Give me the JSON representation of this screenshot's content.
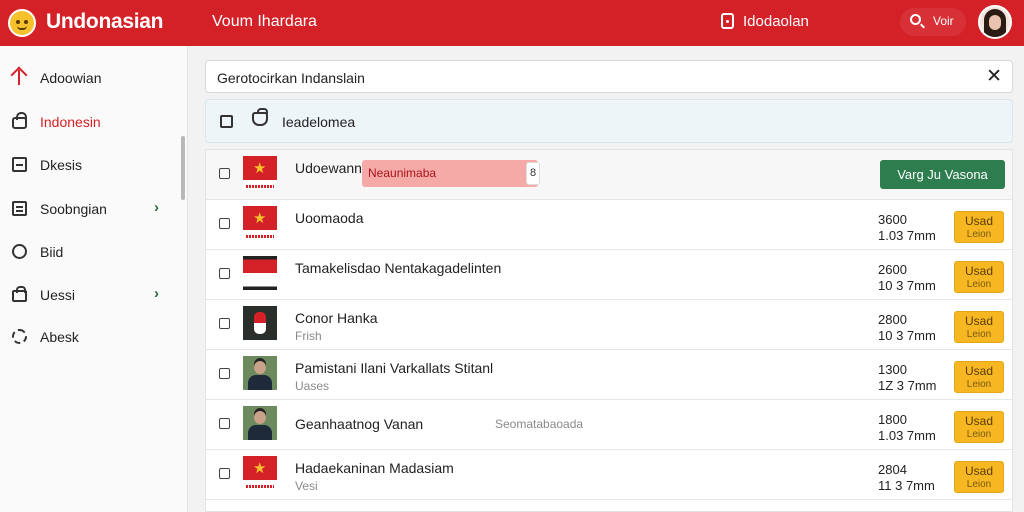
{
  "header": {
    "title": "Undonasian",
    "subtitle": "Voum Ihardara",
    "location": "Idodaolan",
    "search_label": "Voir"
  },
  "sidebar": {
    "items": [
      {
        "label": "Adoowian",
        "icon": "home-icon",
        "active": false
      },
      {
        "label": "Indonesin",
        "icon": "lock-icon",
        "active": true
      },
      {
        "label": "Dkesis",
        "icon": "document-icon",
        "active": false
      },
      {
        "label": "Soobngian",
        "icon": "list-icon",
        "active": false,
        "expandable": true
      },
      {
        "label": "Biid",
        "icon": "circle-icon",
        "active": false
      },
      {
        "label": "Uessi",
        "icon": "bag-icon",
        "active": false,
        "expandable": true
      },
      {
        "label": "Abesk",
        "icon": "gear-icon",
        "active": false
      }
    ]
  },
  "search": {
    "value": "Gerotocirkan Indanslain"
  },
  "filter": {
    "label": "Ieadelomea"
  },
  "list": {
    "rows": [
      {
        "title": "Udoewann",
        "tag": "Neaunimaba",
        "tag_badge": "8",
        "action": "Varg Ju Vasona",
        "thumb": "flag-vn"
      },
      {
        "title": "Uoomaoda",
        "sub": "",
        "num1": "3600",
        "num2": "1.03 7mm",
        "btn1": "Usad",
        "btn2": "Leion",
        "thumb": "flag-vn"
      },
      {
        "title": "Tamakelisdao Nentakagadelinten",
        "sub": "",
        "num1": "2600",
        "num2": "10 3 7mm",
        "btn1": "Usad",
        "btn2": "Leion",
        "thumb": "flag-id"
      },
      {
        "title": "Conor Hanka",
        "sub": "Frish",
        "num1": "2800",
        "num2": "10 3 7mm",
        "btn1": "Usad",
        "btn2": "Leion",
        "thumb": "dark"
      },
      {
        "title": "Pamistani Ilani Varkallats Stitanl",
        "sub": "Uases",
        "num1": "1300",
        "num2": "1Z 3 7mm",
        "btn1": "Usad",
        "btn2": "Leion",
        "thumb": "person"
      },
      {
        "title": "Geanhaatnog Vanan",
        "extra": "Seomatabaoada",
        "num1": "1800",
        "num2": "1.03 7mm",
        "btn1": "Usad",
        "btn2": "Leion",
        "thumb": "person"
      },
      {
        "title": "Hadaekaninan Madasiam",
        "sub": "Vesi",
        "num1": "2804",
        "num2": "11 3 7mm",
        "btn1": "Usad",
        "btn2": "Leion",
        "thumb": "flag-vn"
      }
    ]
  },
  "colors": {
    "brand": "#d42027",
    "action_green": "#2e7d4f",
    "button_yellow": "#f6b722"
  }
}
